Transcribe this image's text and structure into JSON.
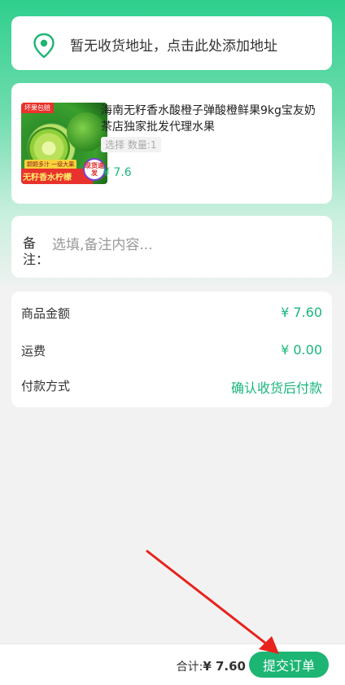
{
  "address": {
    "prompt": "暂无收货地址，点击此处添加地址"
  },
  "product": {
    "image_tags": {
      "top": "坏果包赔",
      "sub": "颗颗多汁 一级大果",
      "bottom": "无籽香水柠檬",
      "badge": "现货速发"
    },
    "title": "海南无籽香水酸橙子弹酸橙鲜果9kg宝友奶茶店独家批发代理水果",
    "spec": "选择 数量:1",
    "price": "¥ 7.6"
  },
  "note": {
    "label": "备注：",
    "placeholder": "选填,备注内容..."
  },
  "summary": {
    "rows": [
      {
        "label": "商品金额",
        "value": "¥ 7.60"
      },
      {
        "label": "运费",
        "value": "¥ 0.00"
      },
      {
        "label": "付款方式",
        "value": "确认收货后付款"
      }
    ]
  },
  "footer": {
    "total_label": "合计:",
    "total_value": "¥ 7.60",
    "submit_label": "提交订单"
  },
  "colors": {
    "accent": "#1db574",
    "price": "#19b77a",
    "annotation_arrow": "#e8221c"
  }
}
